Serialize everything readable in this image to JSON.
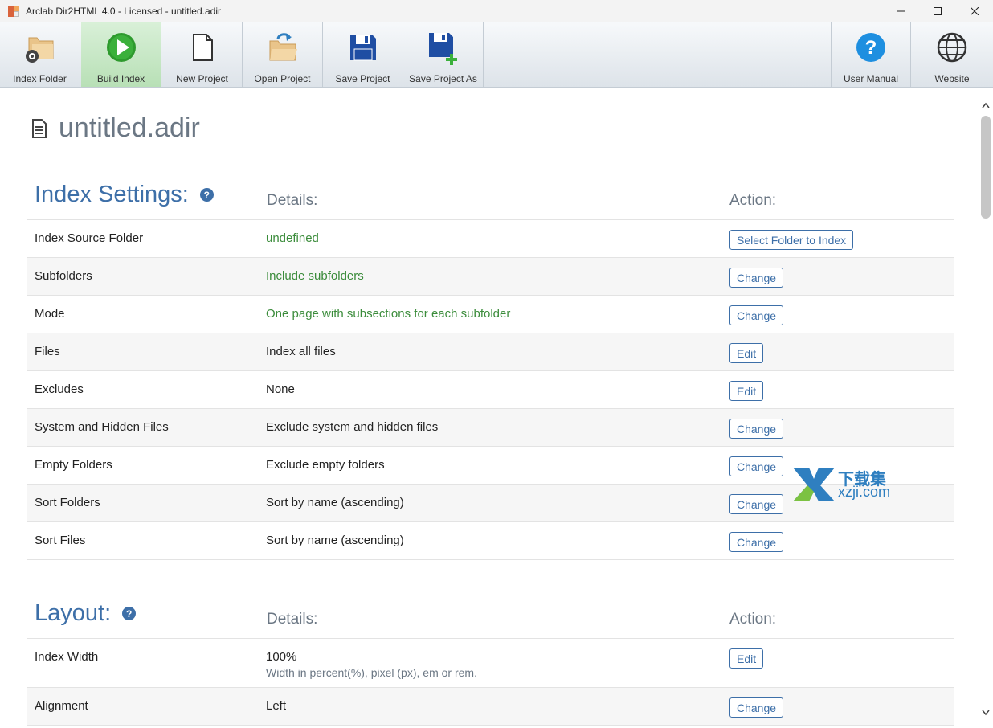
{
  "window": {
    "title": "Arclab Dir2HTML 4.0 - Licensed - untitled.adir"
  },
  "toolbar": {
    "items": [
      {
        "label": "Index Folder",
        "icon": "index-folder-icon"
      },
      {
        "label": "Build Index",
        "icon": "play-icon"
      },
      {
        "label": "New Project",
        "icon": "new-document-icon"
      },
      {
        "label": "Open Project",
        "icon": "open-folder-icon"
      },
      {
        "label": "Save Project",
        "icon": "floppy-icon"
      },
      {
        "label": "Save Project As",
        "icon": "floppy-plus-icon"
      },
      {
        "label": "User Manual",
        "icon": "help-icon"
      },
      {
        "label": "Website",
        "icon": "globe-icon"
      }
    ]
  },
  "page": {
    "file_title": "untitled.adir"
  },
  "index_settings": {
    "title": "Index Settings:",
    "help": "?",
    "details_header": "Details:",
    "action_header": "Action:",
    "rows": [
      {
        "name": "Index Source Folder",
        "detail": "undefined",
        "action": "Select Folder to Index"
      },
      {
        "name": "Subfolders",
        "detail": "Include subfolders",
        "action": "Change"
      },
      {
        "name": "Mode",
        "detail": "One page with subsections for each subfolder",
        "action": "Change"
      },
      {
        "name": "Files",
        "detail": "Index all files",
        "action": "Edit"
      },
      {
        "name": "Excludes",
        "detail": "None",
        "action": "Edit"
      },
      {
        "name": "System and Hidden Files",
        "detail": "Exclude system and hidden files",
        "action": "Change"
      },
      {
        "name": "Empty Folders",
        "detail": "Exclude empty folders",
        "action": "Change"
      },
      {
        "name": "Sort Folders",
        "detail": "Sort by name (ascending)",
        "action": "Change"
      },
      {
        "name": "Sort Files",
        "detail": "Sort by name (ascending)",
        "action": "Change"
      }
    ]
  },
  "layout": {
    "title": "Layout:",
    "help": "?",
    "details_header": "Details:",
    "action_header": "Action:",
    "rows": [
      {
        "name": "Index Width",
        "detail": "100%",
        "subdetail": "Width in percent(%), pixel (px), em or rem.",
        "action": "Edit"
      },
      {
        "name": "Alignment",
        "detail": "Left",
        "action": "Change"
      }
    ]
  },
  "watermark": {
    "line1": "下载集",
    "line2": "xzji.com"
  },
  "colors": {
    "accent": "#3d6fa8",
    "green": "#3b8c3b",
    "muted": "#6b7784"
  }
}
